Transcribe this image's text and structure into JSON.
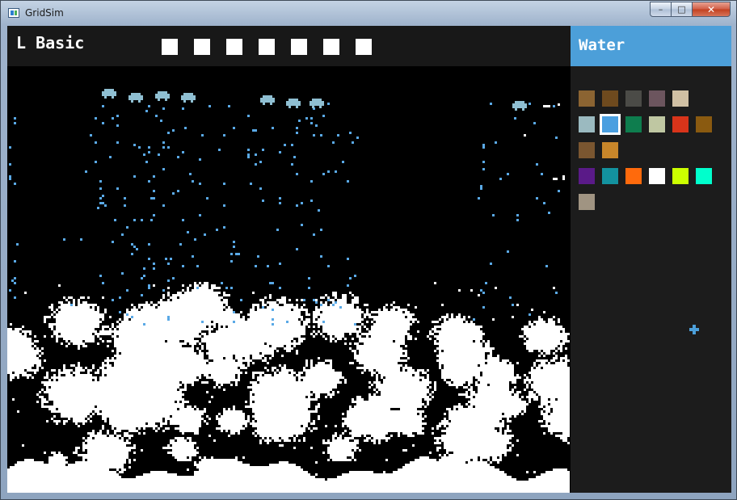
{
  "window": {
    "title": "GridSim",
    "minimize_icon": "minimize-icon",
    "maximize_icon": "maximize-icon",
    "close_icon": "close-icon",
    "minimize_glyph": "–",
    "maximize_glyph": "□",
    "close_glyph": "✕"
  },
  "toolbar": {
    "mode_label": "L Basic",
    "tool_count": 7
  },
  "side_panel": {
    "selected_material": "Water",
    "accent_color": "#4c9fd9",
    "swatches": [
      {
        "color": "#8b6432",
        "selected": false
      },
      {
        "color": "#6e4a1e",
        "selected": false
      },
      {
        "color": "#4b4b47",
        "selected": false
      },
      {
        "color": "#6c555e",
        "selected": false
      },
      {
        "color": "#d0c0a4",
        "selected": false
      },
      {
        "color": "#9bbac0",
        "selected": false
      },
      {
        "color": "#4a9fe0",
        "selected": true
      },
      {
        "color": "#0e7d4e",
        "selected": false
      },
      {
        "color": "#bfc7a2",
        "selected": false
      },
      {
        "color": "#d8341a",
        "selected": false
      },
      {
        "color": "#8a5a10",
        "selected": false
      },
      {
        "color": "#7a5630",
        "selected": false
      },
      {
        "color": "#c8862a",
        "selected": false
      },
      {
        "color": "#5a1a88",
        "selected": false
      },
      {
        "color": "#13929f",
        "selected": false
      },
      {
        "color": "#ff6a0c",
        "selected": false
      },
      {
        "color": "#ffffff",
        "selected": false
      },
      {
        "color": "#ccff00",
        "selected": false
      },
      {
        "color": "#00ffcc",
        "selected": false
      },
      {
        "color": "#a09482",
        "selected": false
      }
    ],
    "cursor_icon": "crosshair-cursor-icon",
    "cursor_color": "#4c9fd9"
  },
  "simulation": {
    "background_color": "#000000",
    "solid_color": "#ffffff",
    "water_color": "#5aa9e6",
    "emitter_color": "#8fbfd2"
  }
}
